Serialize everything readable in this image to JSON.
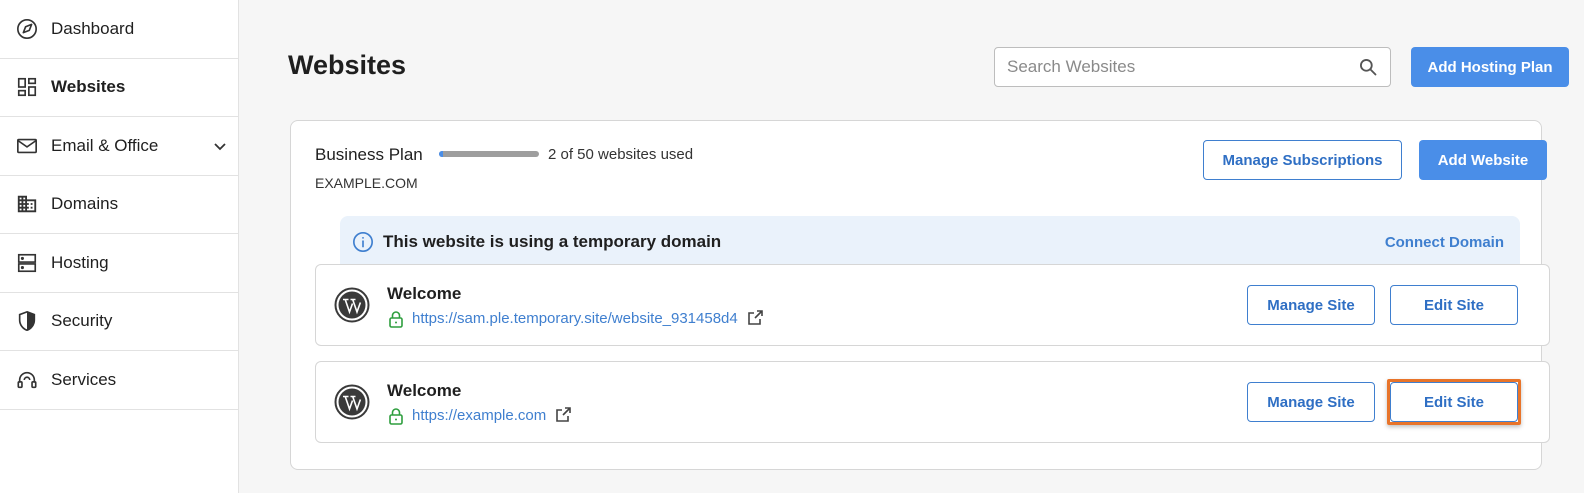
{
  "sidebar": {
    "items": [
      {
        "label": "Dashboard",
        "icon": "compass-icon"
      },
      {
        "label": "Websites",
        "icon": "grid-icon",
        "active": true
      },
      {
        "label": "Email & Office",
        "icon": "mail-icon",
        "expandable": true
      },
      {
        "label": "Domains",
        "icon": "building-icon"
      },
      {
        "label": "Hosting",
        "icon": "server-icon"
      },
      {
        "label": "Security",
        "icon": "shield-icon"
      },
      {
        "label": "Services",
        "icon": "headset-icon"
      }
    ]
  },
  "header": {
    "title": "Websites",
    "search_placeholder": "Search Websites",
    "add_hosting_label": "Add Hosting Plan"
  },
  "plan": {
    "name": "Business Plan",
    "usage_text": "2 of 50 websites used",
    "usage_fraction": 0.04,
    "domain": "EXAMPLE.COM",
    "manage_subscriptions_label": "Manage Subscriptions",
    "add_website_label": "Add Website",
    "banner_text": "This website is using a temporary domain",
    "connect_domain_label": "Connect Domain",
    "sites": [
      {
        "title": "Welcome",
        "url": "https://sam.ple.temporary.site/website_931458d4",
        "manage_label": "Manage Site",
        "edit_label": "Edit Site"
      },
      {
        "title": "Welcome",
        "url": "https://example.com",
        "manage_label": "Manage Site",
        "edit_label": "Edit Site"
      }
    ]
  },
  "colors": {
    "accent": "#4a8ee8",
    "link": "#3f7fcf",
    "banner_bg": "#eaf2fb",
    "highlight": "#e8742a",
    "lock": "#2e9e3e"
  }
}
